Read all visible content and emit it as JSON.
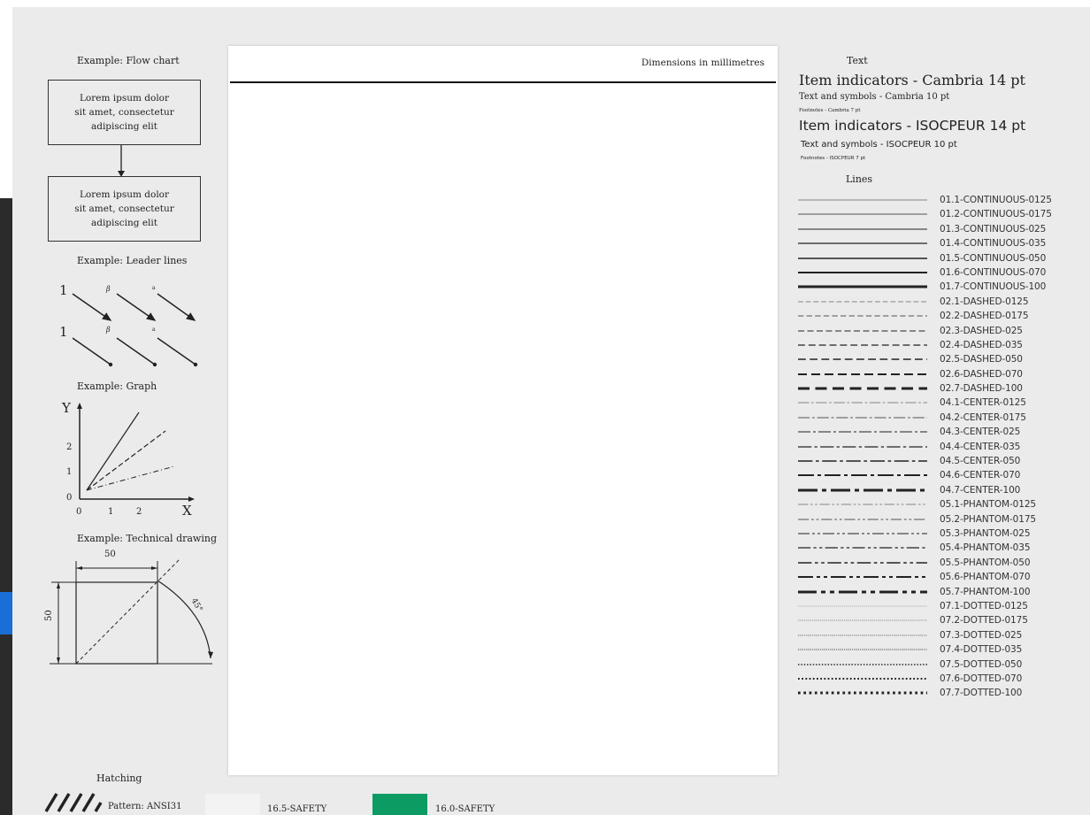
{
  "left_panel": {
    "flowchart": {
      "title": "Example: Flow chart",
      "box1_lines": [
        "Lorem ipsum dolor",
        "sit amet, consectetur",
        "adipiscing elit"
      ],
      "box2_lines": [
        "Lorem ipsum dolor",
        "sit amet, consectetur",
        "adipiscing elit"
      ]
    },
    "leader": {
      "title": "Example: Leader lines",
      "row1_labels": [
        "1",
        "β",
        "a"
      ],
      "row2_labels": [
        "1",
        "β",
        "a"
      ]
    },
    "graph": {
      "title": "Example: Graph",
      "y_label": "Y",
      "x_label": "X",
      "y_ticks": [
        "2",
        "1",
        "0"
      ],
      "x_ticks": [
        "0",
        "1",
        "2"
      ]
    },
    "drawing": {
      "title": "Example: Technical drawing",
      "width_dim": "50",
      "height_dim": "50",
      "angle": "45°"
    },
    "hatching": {
      "title": "Hatching",
      "pattern_label": "Pattern: ANSI31"
    }
  },
  "sheet": {
    "dimension_note": "Dimensions in millimetres"
  },
  "text_panel": {
    "title": "Text",
    "cambria_item": "Item indicators - Cambria 14 pt",
    "cambria_text": "Text and symbols - Cambria 10 pt",
    "cambria_foot": "Footnotes - Cambria 7 pt",
    "iso_item": "Item indicators - ISOCPEUR 14 pt",
    "iso_text": "Text and symbols - ISOCPEUR 10 pt",
    "iso_foot": "Footnotes - ISOCPEUR 7 pt"
  },
  "lines_panel": {
    "title": "Lines",
    "items": [
      {
        "label": "01.1-CONTINUOUS-0125"
      },
      {
        "label": "01.2-CONTINUOUS-0175"
      },
      {
        "label": "01.3-CONTINUOUS-025"
      },
      {
        "label": "01.4-CONTINUOUS-035"
      },
      {
        "label": "01.5-CONTINUOUS-050"
      },
      {
        "label": "01.6-CONTINUOUS-070"
      },
      {
        "label": "01.7-CONTINUOUS-100"
      },
      {
        "label": "02.1-DASHED-0125"
      },
      {
        "label": "02.2-DASHED-0175"
      },
      {
        "label": "02.3-DASHED-025"
      },
      {
        "label": "02.4-DASHED-035"
      },
      {
        "label": "02.5-DASHED-050"
      },
      {
        "label": "02.6-DASHED-070"
      },
      {
        "label": "02.7-DASHED-100"
      },
      {
        "label": "04.1-CENTER-0125"
      },
      {
        "label": "04.2-CENTER-0175"
      },
      {
        "label": "04.3-CENTER-025"
      },
      {
        "label": "04.4-CENTER-035"
      },
      {
        "label": "04.5-CENTER-050"
      },
      {
        "label": "04.6-CENTER-070"
      },
      {
        "label": "04.7-CENTER-100"
      },
      {
        "label": "05.1-PHANTOM-0125"
      },
      {
        "label": "05.2-PHANTOM-0175"
      },
      {
        "label": "05.3-PHANTOM-025"
      },
      {
        "label": "05.4-PHANTOM-035"
      },
      {
        "label": "05.5-PHANTOM-050"
      },
      {
        "label": "05.6-PHANTOM-070"
      },
      {
        "label": "05.7-PHANTOM-100"
      },
      {
        "label": "07.1-DOTTED-0125"
      },
      {
        "label": "07.2-DOTTED-0175"
      },
      {
        "label": "07.3-DOTTED-025"
      },
      {
        "label": "07.4-DOTTED-035"
      },
      {
        "label": "07.5-DOTTED-050"
      },
      {
        "label": "07.6-DOTTED-070"
      },
      {
        "label": "07.7-DOTTED-100"
      }
    ]
  },
  "swatches": {
    "safety_165_label": "16.5-SAFETY",
    "safety_160_label": "16.0-SAFETY",
    "safety_160_color": "#0d9b64",
    "safety_165_color": "#f3f3f3"
  },
  "colors": {
    "accent_strip": "#1a6fd6",
    "dark_strip": "#2b2b2b"
  }
}
